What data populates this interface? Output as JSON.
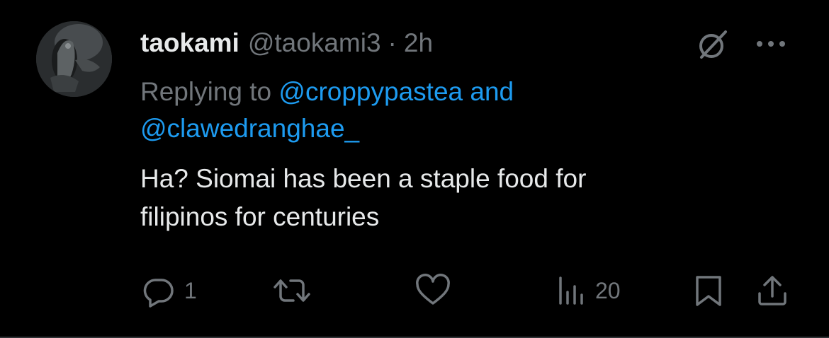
{
  "tweet": {
    "display_name": "taokami",
    "handle": "@taokami3",
    "separator": "·",
    "time": "2h",
    "replying_prefix": "Replying to ",
    "replying_mention_1": "@croppypastea",
    "replying_conjunction": " and",
    "replying_mention_2": "@clawedranghae_",
    "body_line_1": "Ha? Siomai has been a staple food for",
    "body_line_2": "filipinos for centuries"
  },
  "actions": {
    "reply_count": "1",
    "repost_count": "",
    "like_count": "",
    "views_count": "20"
  },
  "icons": {
    "grok": "grok-icon",
    "more": "more-icon",
    "reply": "reply-icon",
    "repost": "repost-icon",
    "like": "like-icon",
    "views": "views-icon",
    "bookmark": "bookmark-icon",
    "share": "share-icon"
  },
  "colors": {
    "background": "#000000",
    "primary_text": "#e7e9ea",
    "secondary_text": "#71767b",
    "mention": "#1d9bf0",
    "divider": "#2f3336"
  }
}
